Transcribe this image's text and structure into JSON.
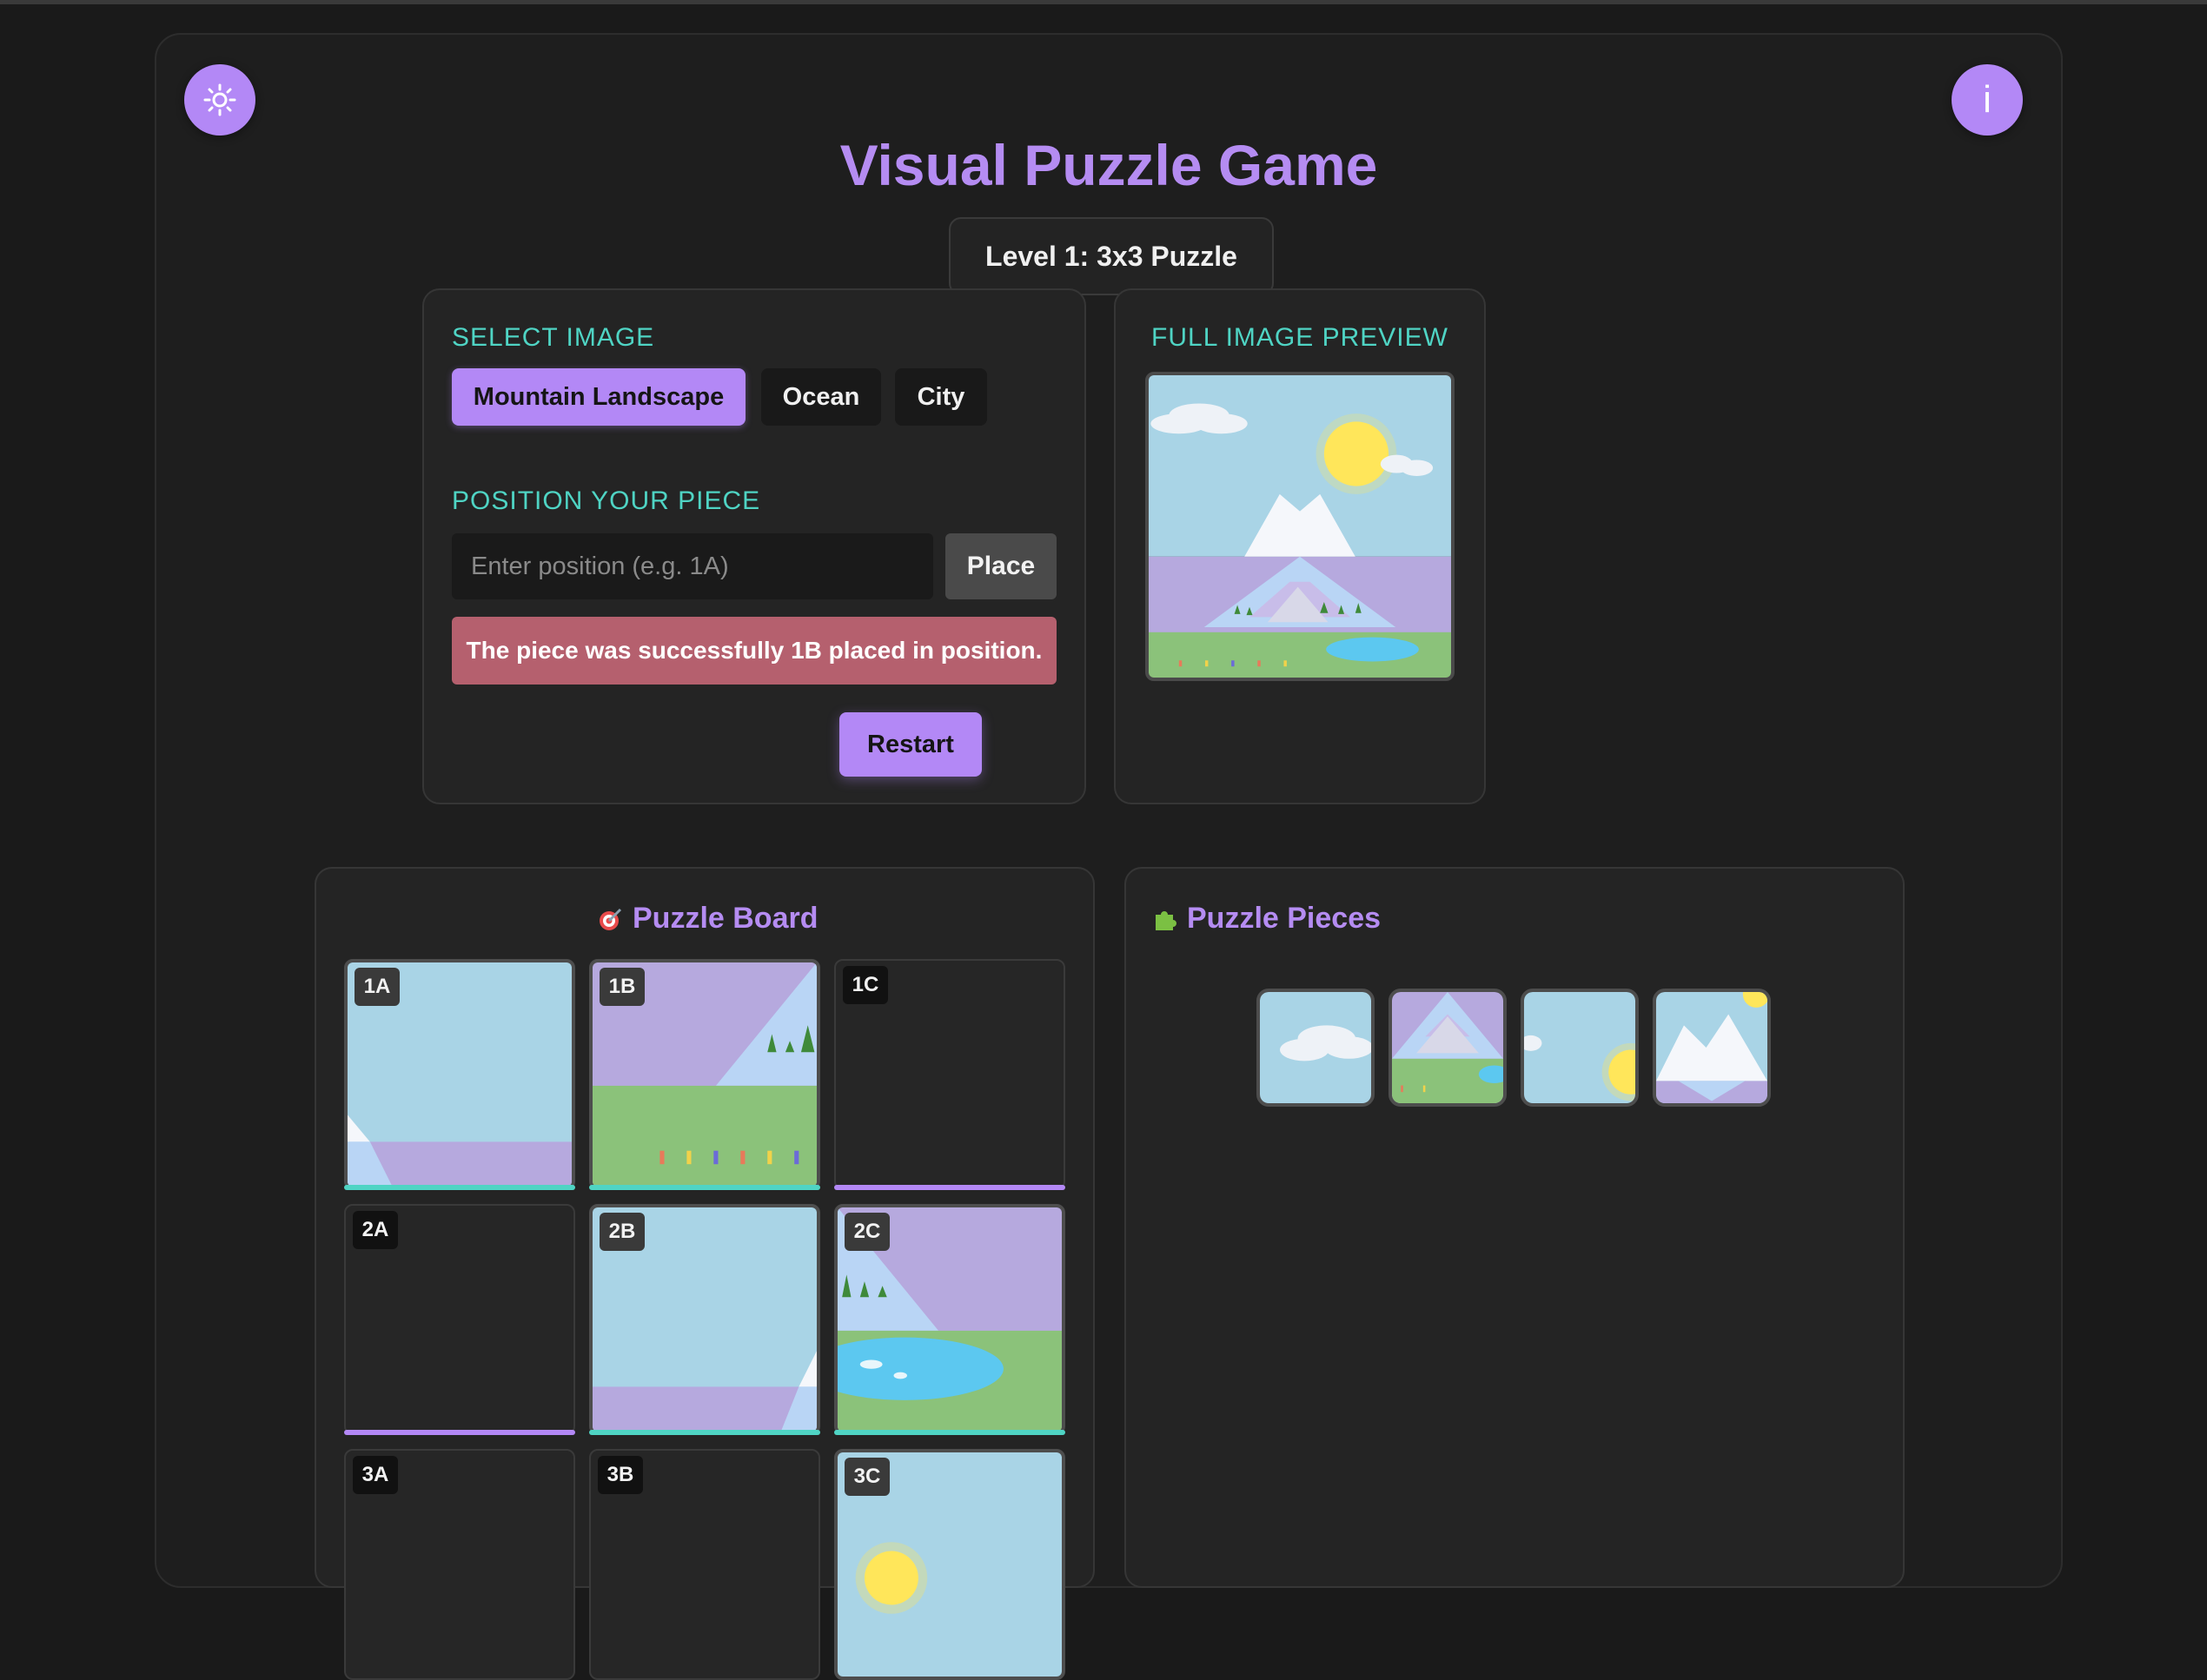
{
  "app": {
    "title": "Visual Puzzle Game",
    "level": "Level 1: 3x3 Puzzle"
  },
  "header": {
    "theme_icon": "sun-icon",
    "info_icon": "info-icon",
    "info_label": "i"
  },
  "controls": {
    "select_image_label": "SELECT IMAGE",
    "images": [
      {
        "label": "Mountain Landscape",
        "active": true
      },
      {
        "label": "Ocean",
        "active": false
      },
      {
        "label": "City",
        "active": false
      }
    ],
    "position_label": "POSITION YOUR PIECE",
    "position_placeholder": "Enter position (e.g. 1A)",
    "position_value": "",
    "place_label": "Place",
    "message": "The piece was successfully 1B placed in position.",
    "restart_label": "Restart"
  },
  "preview": {
    "label": "FULL IMAGE PREVIEW"
  },
  "board": {
    "title": "Puzzle Board",
    "icon": "target-icon",
    "cells": [
      {
        "id": "1A",
        "filled": true,
        "status": "correct"
      },
      {
        "id": "1B",
        "filled": true,
        "status": "correct"
      },
      {
        "id": "1C",
        "filled": false,
        "status": "empty"
      },
      {
        "id": "2A",
        "filled": false,
        "status": "empty"
      },
      {
        "id": "2B",
        "filled": true,
        "status": "correct"
      },
      {
        "id": "2C",
        "filled": true,
        "status": "correct"
      },
      {
        "id": "3A",
        "filled": false,
        "status": "empty"
      },
      {
        "id": "3B",
        "filled": false,
        "status": "empty"
      },
      {
        "id": "3C",
        "filled": true,
        "status": "correct"
      }
    ]
  },
  "pieces": {
    "title": "Puzzle Pieces",
    "icon": "puzzle-piece-icon",
    "count": 4
  },
  "colors": {
    "accent": "#b388f6",
    "teal": "#4fd4c4",
    "error": "#b5606e",
    "sky": "#a9d4e6",
    "haze": "#b6a9de",
    "grass": "#8bc27a",
    "sun": "#ffe65a",
    "lake": "#5cc8f0"
  }
}
